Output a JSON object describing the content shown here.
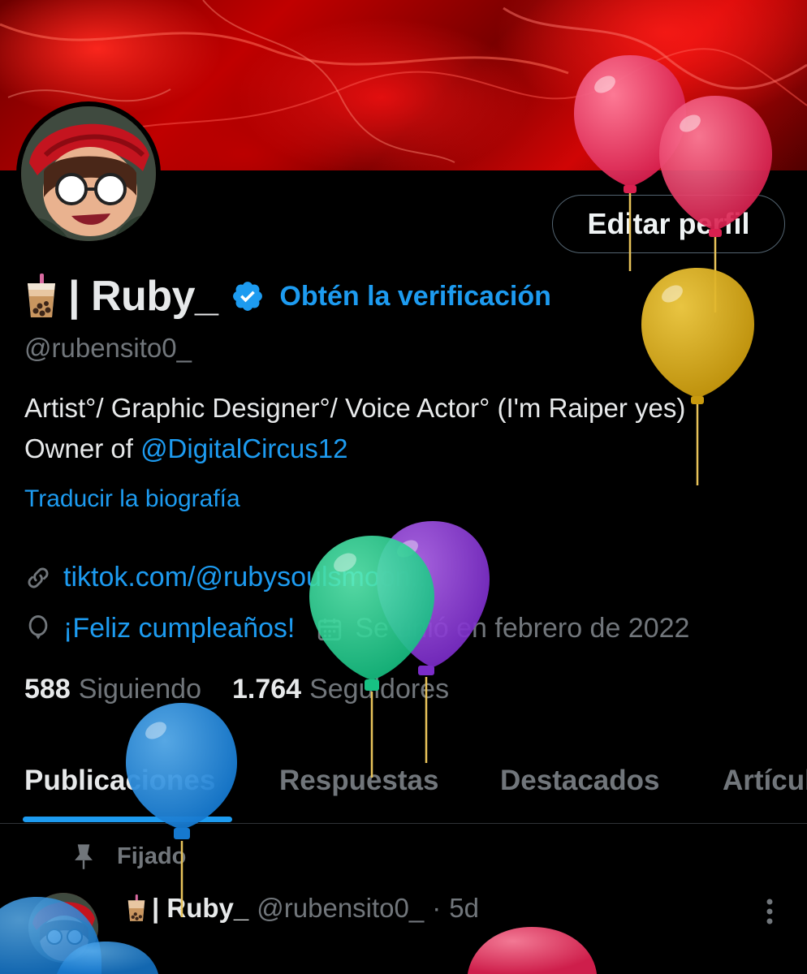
{
  "profile": {
    "button_label": "Editar perfil",
    "display_name": "| Ruby_",
    "verify_label": "Obtén la verificación",
    "handle": "@rubensito0_",
    "bio_text": "Artist°/ Graphic Designer°/ Voice Actor° (I'm Raiper yes) Owner of ",
    "bio_mention": "@DigitalCircus12",
    "translate_label": "Traducir la biografía",
    "link": "tiktok.com/@rubysoulsmoon...",
    "birthday": "¡Feliz cumpleaños!",
    "joined": "Se unió en febrero de 2022",
    "following_count": "588",
    "following_label": "Siguiendo",
    "followers_count": "1.764",
    "followers_label": "Seguidores"
  },
  "tabs": [
    {
      "label": "Publicaciones",
      "active": true
    },
    {
      "label": "Respuestas",
      "active": false
    },
    {
      "label": "Destacados",
      "active": false
    },
    {
      "label": "Artículos",
      "active": false
    }
  ],
  "pinned_label": "Fijado",
  "tweet": {
    "name": "| Ruby_",
    "handle": "@rubensito0_",
    "separator": "·",
    "age": "5d"
  },
  "icons": {
    "avatar_emoji": "bubble-tea-icon",
    "verified": "verified-badge-icon",
    "link": "link-icon",
    "birthday": "balloon-icon",
    "joined": "calendar-icon",
    "pin": "pin-icon",
    "more": "more-vertical-icon"
  },
  "colors": {
    "accent": "#1d9bf0",
    "background": "#000000",
    "text": "#e7e9ea",
    "muted": "#71767b"
  }
}
